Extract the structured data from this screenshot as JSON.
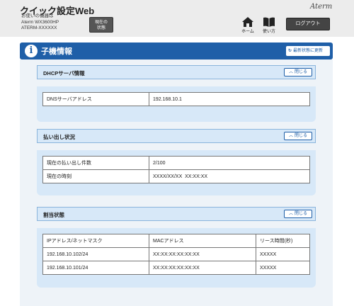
{
  "header": {
    "app_title": "クイック設定Web",
    "device_lines": [
      "お使いの機器は",
      "Aterm WX3600HP",
      "ATERM-XXXXXX"
    ],
    "status_button": [
      "現在の",
      "状態"
    ],
    "brand": "Aterm",
    "nav": {
      "home_label": "ホーム",
      "help_label": "使い方"
    },
    "logout_label": "ログアウト"
  },
  "page": {
    "title": "子機情報",
    "refresh_label": "最新状態に更新"
  },
  "panels": {
    "dhcp": {
      "title": "DHCPサーバ情報",
      "close_label": "閉じる",
      "rows": [
        [
          "DNSサーバアドレス",
          "192.168.10.1"
        ]
      ]
    },
    "lease": {
      "title": "払い出し状況",
      "close_label": "閉じる",
      "rows": [
        [
          "現在の払い出し件数",
          "2/100"
        ],
        [
          "現在の時刻",
          "XXXX/XX/XX  XX:XX:XX"
        ]
      ]
    },
    "assign": {
      "title": "割当状態",
      "close_label": "閉じる",
      "headers": [
        "IPアドレス/ネットマスク",
        "MACアドレス",
        "リース時間(秒)"
      ],
      "rows": [
        [
          "192.168.10.102/24",
          "XX:XX:XX:XX:XX:XX",
          "XXXXX"
        ],
        [
          "192.168.10.101/24",
          "XX:XX:XX:XX:XX:XX",
          "XXXXX"
        ]
      ]
    }
  },
  "colors": {
    "accent": "#1f5fa8",
    "panel": "#d7e8f8",
    "content_bg": "#eef3f8"
  },
  "icons": [
    "info-icon",
    "home-icon",
    "book-icon",
    "refresh-icon",
    "chevron-up-icon"
  ]
}
